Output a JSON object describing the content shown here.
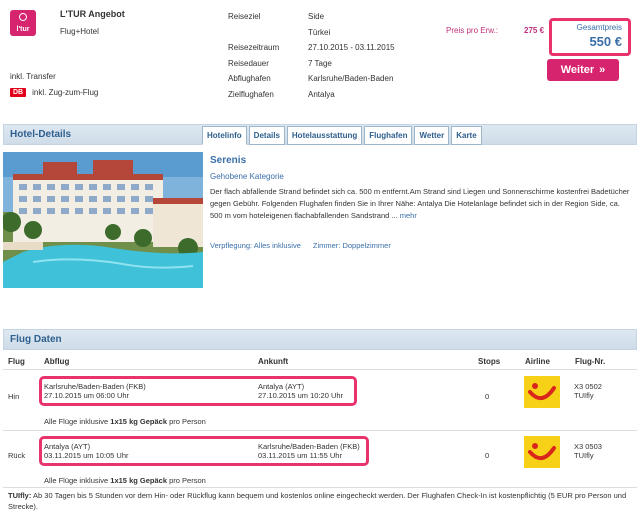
{
  "offer": {
    "title": "L'TUR Angebot",
    "type": "Flug+Hotel",
    "transfer": "inkl. Transfer",
    "train_badge": "DB",
    "train": "inkl. Zug-zum-Flug",
    "logo_text": "l'tur"
  },
  "details": [
    {
      "label": "Reiseziel",
      "value": "Side"
    },
    {
      "label": "",
      "value": "Türkei"
    },
    {
      "label": "Reisezeitraum",
      "value": "27.10.2015 - 03.11.2015"
    },
    {
      "label": "Reisedauer",
      "value": "7 Tage"
    },
    {
      "label": "Abflughafen",
      "value": "Karlsruhe/Baden-Baden"
    },
    {
      "label": "Zielflughafen",
      "value": "Antalya"
    }
  ],
  "price": {
    "per_person_label": "Preis pro Erw.:",
    "per_person_value": "275 €",
    "total_label": "Gesamtpreis",
    "total_value": "550 €",
    "next_button": "Weiter",
    "next_icon": "»"
  },
  "hotel": {
    "section_title": "Hotel-Details",
    "tabs": [
      "Hotelinfo",
      "Details",
      "Hotelausstattung",
      "Flughafen",
      "Wetter",
      "Karte"
    ],
    "name": "Serenis",
    "category": "Gehobene Kategorie",
    "description": "Der flach abfallende Strand befindet sich ca. 500 m entfernt.Am Strand sind Liegen und Sonnenschirme kostenfrei Badetücher gegen Gebühr. Folgenden Flughafen finden Sie in Ihrer Nähe: Antalya Die Hotelanlage befindet sich in der Region Side, ca. 500 m vom hoteleigenen flachabfallenden Sandstrand ...",
    "more": "mehr",
    "board": "Verpflegung: Alles inklusive",
    "room": "Zimmer: Doppelzimmer"
  },
  "flights": {
    "section_title": "Flug Daten",
    "headers": {
      "flight": "Flug",
      "departure": "Abflug",
      "arrival": "Ankunft",
      "stops": "Stops",
      "airline": "Airline",
      "number": "Flug-Nr."
    },
    "rows": [
      {
        "direction": "Hin",
        "dep_airport": "Karlsruhe/Baden-Baden (FKB)",
        "dep_time": "27.10.2015 um 06:00 Uhr",
        "arr_airport": "Antalya (AYT)",
        "arr_time": "27.10.2015 um 10:20 Uhr",
        "stops": "0",
        "flight_no": "X3 0502",
        "carrier": "TUIfly"
      },
      {
        "direction": "Rück",
        "dep_airport": "Antalya (AYT)",
        "dep_time": "03.11.2015 um 10:05 Uhr",
        "arr_airport": "Karlsruhe/Baden-Baden (FKB)",
        "arr_time": "03.11.2015 um 11:55 Uhr",
        "stops": "0",
        "flight_no": "X3 0503",
        "carrier": "TUIfly"
      }
    ],
    "baggage": {
      "prefix": "Alle Flüge inklusive",
      "amount": "1x15 kg Gepäck",
      "suffix": "pro Person"
    },
    "footnote_bold": "TUIfly:",
    "footnote": "Ab 30 Tagen bis 5 Stunden vor dem Hin- oder Rückflug kann bequem und kostenlos online eingecheckt werden. Der Flughafen Check-In ist kostenpflichtig (5 EUR pro Person und Strecke)."
  },
  "colors": {
    "brand": "#d6246e",
    "highlight": "#e8336d",
    "link": "#3a6fa8",
    "tui_yellow": "#f7d117"
  }
}
